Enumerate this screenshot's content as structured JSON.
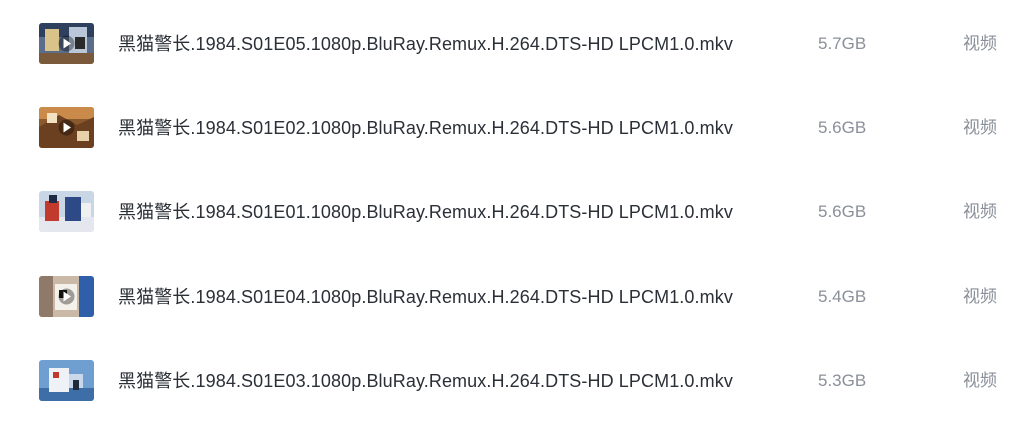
{
  "files": [
    {
      "name": "黑猫警长.1984.S01E05.1080p.BluRay.Remux.H.264.DTS-HD LPCM1.0.mkv",
      "size": "5.7GB",
      "type": "视频",
      "thumb_icon": "video-thumbnail-icon"
    },
    {
      "name": "黑猫警长.1984.S01E02.1080p.BluRay.Remux.H.264.DTS-HD LPCM1.0.mkv",
      "size": "5.6GB",
      "type": "视频",
      "thumb_icon": "video-thumbnail-icon"
    },
    {
      "name": "黑猫警长.1984.S01E01.1080p.BluRay.Remux.H.264.DTS-HD LPCM1.0.mkv",
      "size": "5.6GB",
      "type": "视频",
      "thumb_icon": "video-thumbnail-icon"
    },
    {
      "name": "黑猫警长.1984.S01E04.1080p.BluRay.Remux.H.264.DTS-HD LPCM1.0.mkv",
      "size": "5.4GB",
      "type": "视频",
      "thumb_icon": "video-thumbnail-icon"
    },
    {
      "name": "黑猫警长.1984.S01E03.1080p.BluRay.Remux.H.264.DTS-HD LPCM1.0.mkv",
      "size": "5.3GB",
      "type": "视频",
      "thumb_icon": "video-thumbnail-icon"
    }
  ],
  "colors": {
    "name_text": "#2b2f36",
    "meta_text": "#8a8f99",
    "background": "#ffffff"
  }
}
